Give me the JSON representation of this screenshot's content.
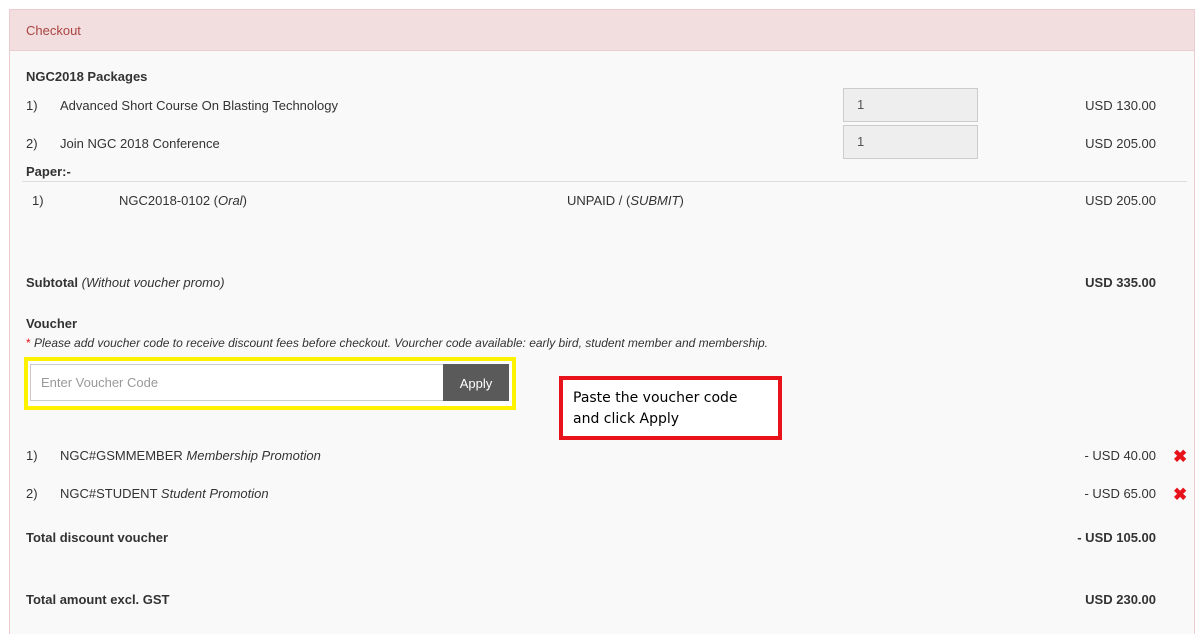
{
  "panel": {
    "title": "Checkout"
  },
  "packages": {
    "heading": "NGC2018 Packages",
    "items": [
      {
        "num": "1)",
        "name": "Advanced Short Course On Blasting Technology",
        "qty": "1",
        "price": "USD 130.00"
      },
      {
        "num": "2)",
        "name": "Join NGC 2018 Conference",
        "qty": "1",
        "price": "USD 205.00"
      }
    ]
  },
  "paper": {
    "heading": "Paper:-",
    "items": [
      {
        "num": "1)",
        "code": "NGC2018-0102",
        "type": "Oral",
        "status": "UNPAID",
        "status_detail": "SUBMIT",
        "price": "USD 205.00"
      }
    ]
  },
  "subtotal": {
    "label": "Subtotal",
    "note": "(Without voucher promo)",
    "value": "USD 335.00"
  },
  "voucher": {
    "heading": "Voucher",
    "asterisk": "*",
    "note": "Please add voucher code to receive discount fees before checkout. Vourcher code available: early bird, student member and membership.",
    "input_placeholder": "Enter Voucher Code",
    "input_value": "",
    "apply_label": "Apply",
    "applied": [
      {
        "num": "1)",
        "code": "NGC#GSMMEMBER",
        "desc": "Membership Promotion",
        "amount": "- USD 40.00"
      },
      {
        "num": "2)",
        "code": "NGC#STUDENT",
        "desc": "Student Promotion",
        "amount": "- USD 65.00"
      }
    ]
  },
  "callout": {
    "line1": "Paste the voucher code",
    "line2": "and click Apply"
  },
  "total_discount": {
    "label": "Total discount voucher",
    "value": "- USD 105.00"
  },
  "total_amount": {
    "label": "Total amount excl. GST",
    "value": "USD 230.00"
  },
  "icons": {
    "remove": "close-x-icon"
  },
  "colors": {
    "heading_bg": "#f2dede",
    "heading_text": "#a94442",
    "highlight": "#fff200",
    "callout_border": "#e8121b",
    "remove_icon": "#e8121b",
    "apply_bg": "#5a5a5a"
  }
}
